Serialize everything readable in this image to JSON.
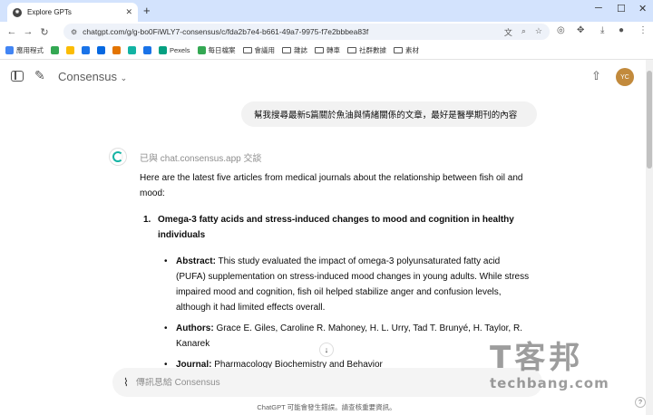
{
  "browser": {
    "tab_title": "Explore GPTs",
    "url": "chatgpt.com/g/g-bo0FiWLY7-consensus/c/fda2b7e4-b661-49a7-9975-f7e2bbbea83f",
    "bookmarks": [
      {
        "label": "應用程式",
        "icon": "apps-grid-icon",
        "color": "#4285f4"
      },
      {
        "label": "",
        "icon": "leaf-icon",
        "color": "#34a853"
      },
      {
        "label": "",
        "icon": "bookmark-app-icon",
        "color": "#fbbc04"
      },
      {
        "label": "",
        "icon": "bookmark-app-icon",
        "color": "#1a73e8"
      },
      {
        "label": "",
        "icon": "meta-icon",
        "color": "#0668e1"
      },
      {
        "label": "",
        "icon": "bookmark-app-icon",
        "color": "#e37400"
      },
      {
        "label": "",
        "icon": "bookmark-app-icon",
        "color": "#12b3a3"
      },
      {
        "label": "",
        "icon": "bookmark-app-icon",
        "color": "#1a73e8"
      },
      {
        "label": "Pexels",
        "icon": "pexels-icon",
        "color": "#05a081"
      },
      {
        "label": "每日檔案",
        "icon": "bookmark-app-icon",
        "color": "#34a853"
      },
      {
        "label": "會議用",
        "icon": "folder-icon",
        "color": "#555555"
      },
      {
        "label": "雜誌",
        "icon": "folder-icon",
        "color": "#555555"
      },
      {
        "label": "轉車",
        "icon": "folder-icon",
        "color": "#555555"
      },
      {
        "label": "社群數據",
        "icon": "folder-icon",
        "color": "#555555"
      },
      {
        "label": "素材",
        "icon": "folder-icon",
        "color": "#555555"
      }
    ]
  },
  "header": {
    "model_name": "Consensus",
    "avatar_initials": "YC"
  },
  "conversation": {
    "user_message": "幫我搜尋最新5篇關於魚油與情緒關係的文章，最好是醫學期刊的內容",
    "source_note": "已與 chat.consensus.app 交談",
    "intro": "Here are the latest five articles from medical journals about the relationship between fish oil and mood:",
    "article": {
      "number": "1.",
      "title": "Omega-3 fatty acids and stress-induced changes to mood and cognition in healthy individuals",
      "abstract_label": "Abstract:",
      "abstract_text": " This study evaluated the impact of omega-3 polyunsaturated fatty acid (PUFA) supplementation on stress-induced mood changes in young adults. While stress impaired mood and cognition, fish oil helped stabilize anger and confusion levels, although it had limited effects overall.",
      "authors_label": "Authors:",
      "authors_text": " Grace E. Giles, Caroline R. Mahoney, H. L. Urry, Tad T. Brunyé, H. Taylor, R. Kanarek",
      "journal_label": "Journal:",
      "journal_text": " Pharmacology Biochemistry and Behavior"
    }
  },
  "composer": {
    "placeholder": "傳訊息給 Consensus"
  },
  "footer": {
    "disclaimer": "ChatGPT 可能會發生錯誤。請查核重要資訊。",
    "help": "?"
  },
  "watermark": {
    "big": "T客邦",
    "small": "techbang.com"
  },
  "colors": {
    "tabbar": "#d3e3fd",
    "avatar": "#c28a3c",
    "consensus_accent": "#12b3a3"
  }
}
